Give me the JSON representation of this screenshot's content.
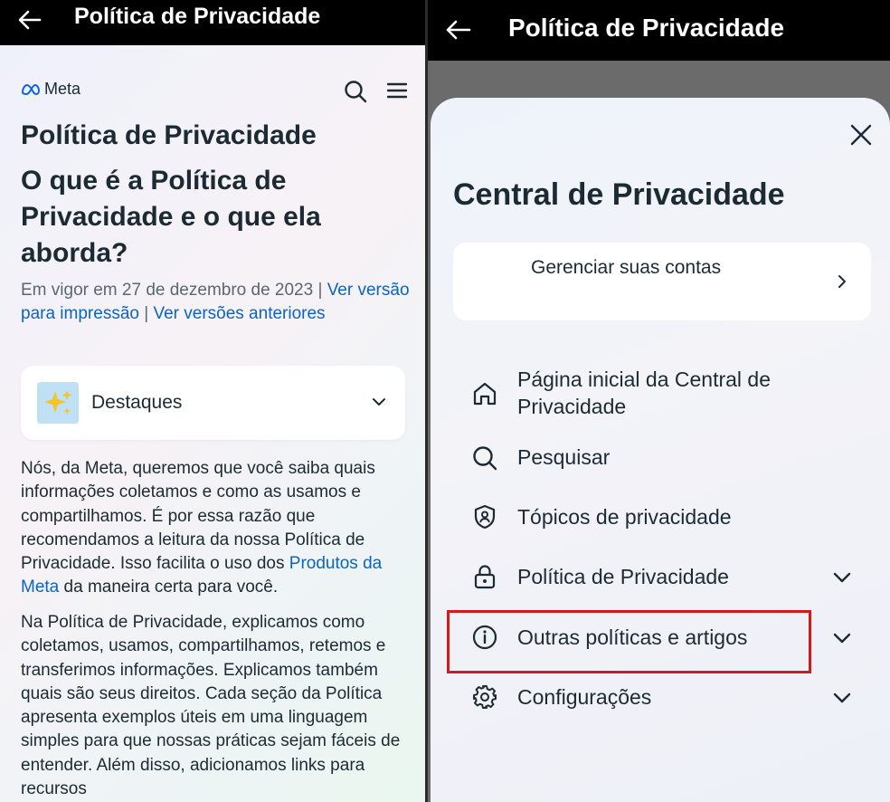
{
  "left": {
    "topbar": {
      "title": "Política de Privacidade"
    },
    "brand": "Meta",
    "page_title": "Política de Privacidade",
    "heading": "O que é a Política de Privacidade e o que ela aborda?",
    "effective": {
      "prefix": "Em vigor em 27 de dezembro de 2023 | ",
      "print_link": "Ver versão para impressão",
      "sep": " | ",
      "versions_link": "Ver versões anteriores"
    },
    "highlights_label": "Destaques",
    "p1": {
      "text": "Nós, da Meta, queremos que você saiba quais informações coletamos e como as usamos e compartilhamos. É por essa razão que recomendamos a leitura da nossa Política de Privacidade. Isso facilita o uso dos ",
      "link": "Produtos da Meta",
      "suffix": " da maneira certa para você."
    },
    "p2": "Na Política de Privacidade, explicamos como coletamos, usamos, compartilhamos, retemos e transferimos informações. Explicamos também quais são seus direitos. Cada seção da Política apresenta exemplos úteis em uma linguagem simples para que nossas práticas sejam fáceis de entender. Além disso, adicionamos links para recursos"
  },
  "right": {
    "topbar": {
      "title": "Política de Privacidade"
    },
    "sheet_title": "Central de Privacidade",
    "manage_label": "Gerenciar suas contas",
    "items": [
      {
        "label": "Página inicial da Central de Privacidade",
        "icon": "home-icon"
      },
      {
        "label": "Pesquisar",
        "icon": "search-icon"
      },
      {
        "label": "Tópicos de privacidade",
        "icon": "shield-icon"
      },
      {
        "label": "Política de Privacidade",
        "icon": "lock-icon"
      },
      {
        "label": "Outras políticas e artigos",
        "icon": "info-icon"
      },
      {
        "label": "Configurações",
        "icon": "gear-icon"
      }
    ]
  },
  "colors": {
    "link": "#0b64c0",
    "text": "#1c2b33",
    "highlight_box": "#d11a1a"
  }
}
